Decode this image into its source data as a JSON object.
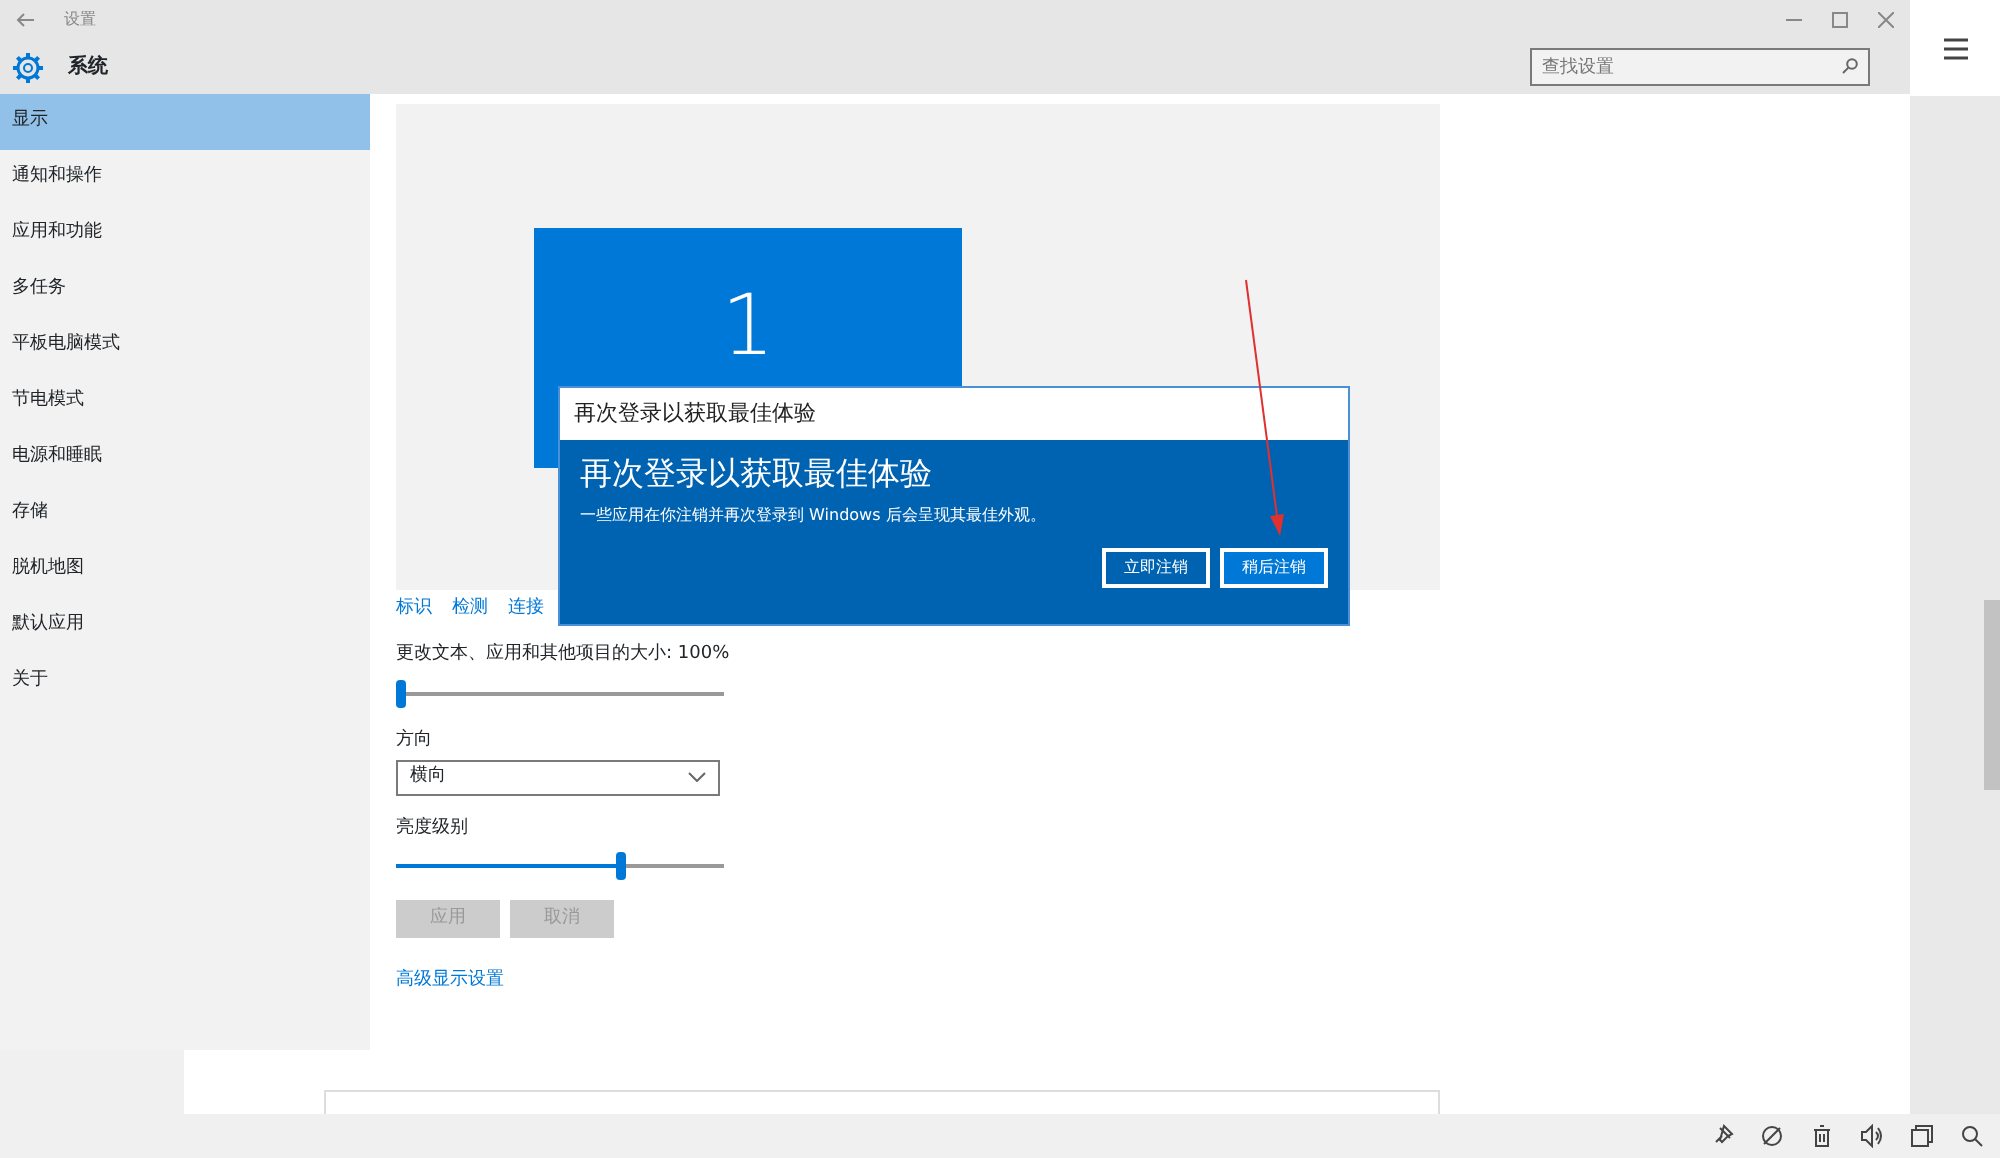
{
  "window": {
    "title": "设置",
    "section": "系统"
  },
  "search": {
    "placeholder": "查找设置"
  },
  "sidebar": {
    "items": [
      {
        "label": "显示",
        "selected": true
      },
      {
        "label": "通知和操作",
        "selected": false
      },
      {
        "label": "应用和功能",
        "selected": false
      },
      {
        "label": "多任务",
        "selected": false
      },
      {
        "label": "平板电脑模式",
        "selected": false
      },
      {
        "label": "节电模式",
        "selected": false
      },
      {
        "label": "电源和睡眠",
        "selected": false
      },
      {
        "label": "存储",
        "selected": false
      },
      {
        "label": "脱机地图",
        "selected": false
      },
      {
        "label": "默认应用",
        "selected": false
      },
      {
        "label": "关于",
        "selected": false
      }
    ]
  },
  "display": {
    "monitor_number": "1",
    "links": [
      "标识",
      "检测",
      "连接"
    ],
    "scale": {
      "label": "更改文本、应用和其他项目的大小: 100%",
      "level": 0.0
    },
    "orientation": {
      "label": "方向",
      "value": "横向"
    },
    "brightness": {
      "label": "亮度级别",
      "level": 0.69
    },
    "buttons": [
      {
        "label": "应用",
        "disabled": true
      },
      {
        "label": "取消",
        "disabled": true
      }
    ],
    "advanced_link": "高级显示设置"
  },
  "dialog": {
    "title": "再次登录以获取最佳体验",
    "heading": "再次登录以获取最佳体验",
    "message": "一些应用在你注销并再次登录到 Windows 后会呈现其最佳外观。",
    "buttons": [
      {
        "label": "立即注销",
        "selected": false
      },
      {
        "label": "稍后注销",
        "selected": true
      }
    ]
  }
}
